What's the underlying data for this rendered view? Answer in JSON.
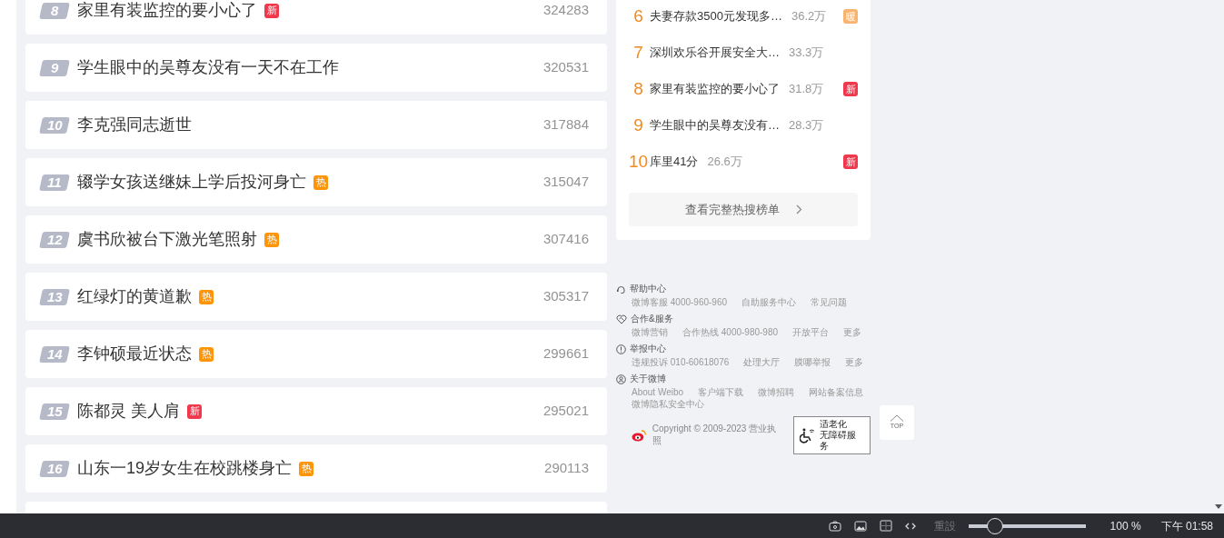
{
  "hot_list": [
    {
      "rank": "8",
      "title": "家里有装监控的要小心了",
      "badge": {
        "kind": "new",
        "text": "新"
      },
      "count": "324283"
    },
    {
      "rank": "9",
      "title": "学生眼中的吴尊友没有一天不在工作",
      "count": "320531"
    },
    {
      "rank": "10",
      "title": "李克强同志逝世",
      "count": "317884"
    },
    {
      "rank": "11",
      "title": "辍学女孩送继妹上学后投河身亡",
      "badge": {
        "kind": "hot",
        "text": "热"
      },
      "count": "315047"
    },
    {
      "rank": "12",
      "title": "虞书欣被台下激光笔照射",
      "badge": {
        "kind": "hot",
        "text": "热"
      },
      "count": "307416"
    },
    {
      "rank": "13",
      "title": "红绿灯的黄道歉",
      "badge": {
        "kind": "hot",
        "text": "热"
      },
      "count": "305317"
    },
    {
      "rank": "14",
      "title": "李钟硕最近状态",
      "badge": {
        "kind": "hot",
        "text": "热"
      },
      "count": "299661"
    },
    {
      "rank": "15",
      "title": "陈都灵 美人肩",
      "badge": {
        "kind": "new",
        "text": "新"
      },
      "count": "295021"
    },
    {
      "rank": "16",
      "title": "山东一19岁女生在校跳楼身亡",
      "badge": {
        "kind": "hot",
        "text": "热"
      },
      "count": "290113"
    }
  ],
  "side_panel": {
    "items": [
      {
        "rank": "6",
        "title": "夫妻存款3500元发现多…",
        "count": "36.2万",
        "badge": {
          "kind": "warm",
          "text": "暖"
        }
      },
      {
        "rank": "7",
        "title": "深圳欢乐谷开展安全大…",
        "count": "33.3万"
      },
      {
        "rank": "8",
        "title": "家里有装监控的要小心了",
        "count": "31.8万",
        "badge": {
          "kind": "new",
          "text": "新"
        }
      },
      {
        "rank": "9",
        "title": "学生眼中的吴尊友没有…",
        "count": "28.3万"
      },
      {
        "rank": "10",
        "title": "库里41分",
        "count": "26.6万",
        "badge": {
          "kind": "new",
          "text": "新"
        }
      }
    ],
    "more_button": "查看完整热搜榜单"
  },
  "footer": {
    "sections": [
      {
        "kind": "help",
        "title": "帮助中心",
        "links": [
          "微博客服 4000-960-960",
          "自助服务中心",
          "常见问题"
        ]
      },
      {
        "kind": "partner",
        "title": "合作&服务",
        "links": [
          "微博营销",
          "合作热线 4000-980-980",
          "开放平台",
          "更多"
        ]
      },
      {
        "kind": "report",
        "title": "举报中心",
        "links": [
          "违规投诉 010-60618076",
          "处理大厅",
          "膜哪举报",
          "更多"
        ]
      },
      {
        "kind": "about",
        "title": "关于微博",
        "links": [
          "About Weibo",
          "客户端下载",
          "微博招聘",
          "网站备案信息",
          "微博隐私安全中心"
        ]
      }
    ],
    "copyright": "Copyright © 2009-2023 营业执照",
    "accessibility_badge": [
      "适老化",
      "无障碍服务"
    ]
  },
  "top_button": "TOP",
  "status_bar": {
    "reset": "重設",
    "zoom": {
      "level": 0.2
    },
    "zoom_reading": "100 %",
    "time": "下午 01:58"
  }
}
